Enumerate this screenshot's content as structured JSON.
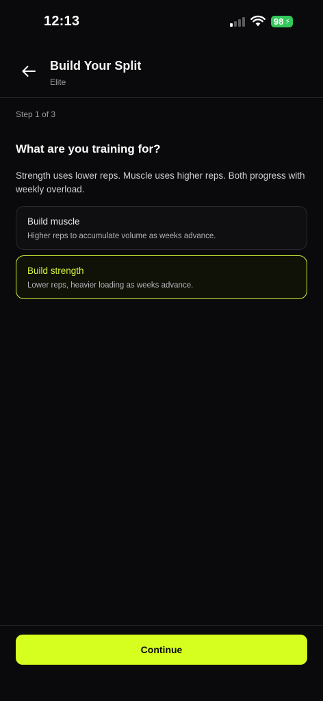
{
  "status_bar": {
    "time": "12:13",
    "battery": "98",
    "battery_color": "#34c759"
  },
  "header": {
    "title": "Build Your Split",
    "subtitle": "Elite",
    "back_icon": "arrow-left-icon"
  },
  "step_label": "Step 1 of 3",
  "question": "What are you training for?",
  "description": "Strength uses lower reps. Muscle uses higher reps. Both progress with weekly overload.",
  "options": [
    {
      "title": "Build muscle",
      "description": "Higher reps to accumulate volume as weeks advance.",
      "selected": false
    },
    {
      "title": "Build strength",
      "description": "Lower reps, heavier loading as weeks advance.",
      "selected": true
    }
  ],
  "continue_label": "Continue",
  "colors": {
    "accent": "#d6ff1f",
    "background": "#0a0a0c"
  }
}
